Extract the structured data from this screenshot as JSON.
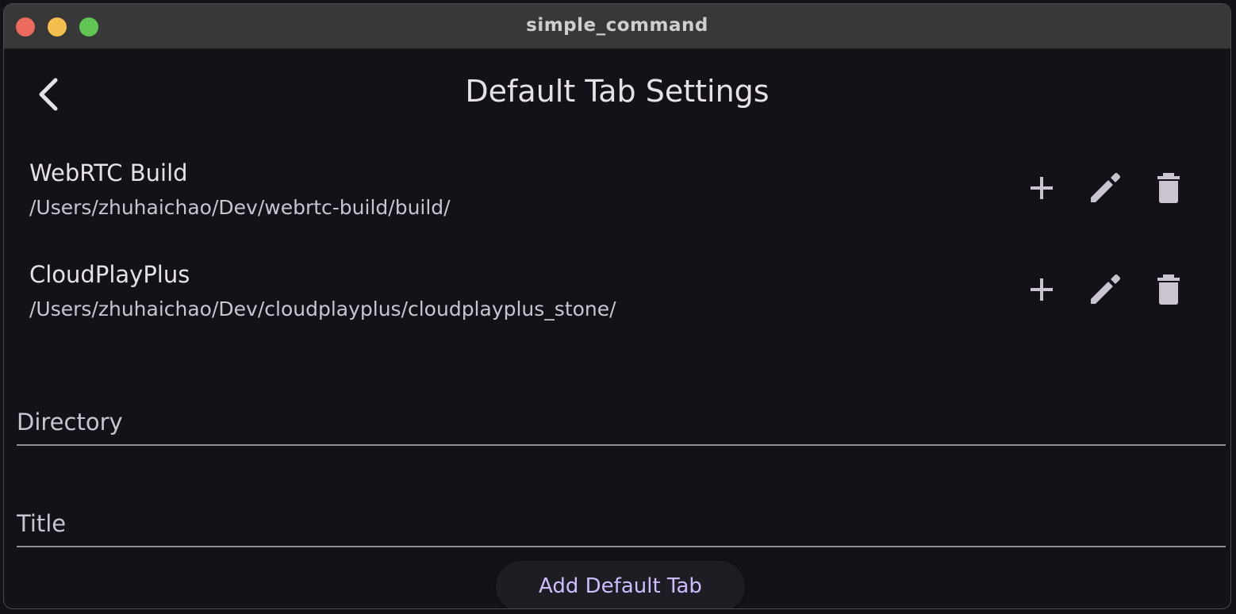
{
  "window": {
    "title": "simple_command"
  },
  "header": {
    "title": "Default Tab Settings",
    "back_icon": "chevron-left-icon"
  },
  "tabs": [
    {
      "title": "WebRTC Build",
      "path": "/Users/zhuhaichao/Dev/webrtc-build/build/"
    },
    {
      "title": "CloudPlayPlus",
      "path": "/Users/zhuhaichao/Dev/cloudplayplus/cloudplayplus_stone/"
    }
  ],
  "form": {
    "directory_placeholder": "Directory",
    "title_placeholder": "Title",
    "directory_value": "",
    "title_value": "",
    "add_button_label": "Add Default Tab"
  },
  "colors": {
    "background": "#141218",
    "titlebar": "#383838",
    "text_primary": "#e6e1e5",
    "icon": "#cac4d0",
    "accent": "#cfbcff"
  }
}
